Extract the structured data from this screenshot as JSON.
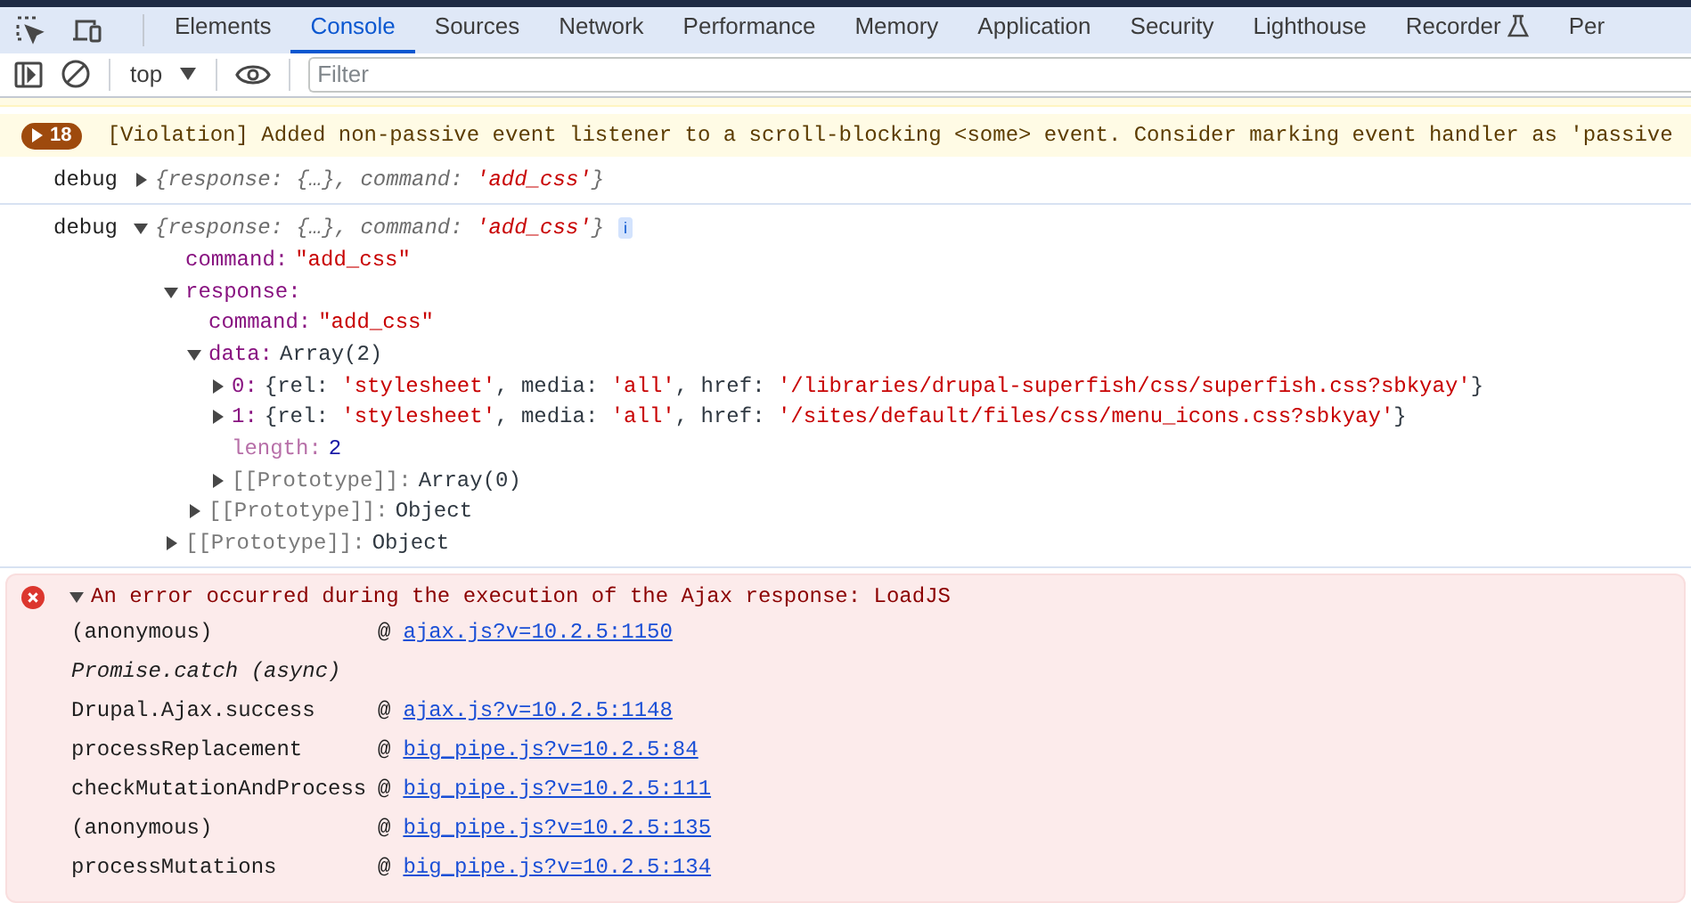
{
  "tabs": [
    {
      "label": "Elements",
      "selected": false
    },
    {
      "label": "Console",
      "selected": true
    },
    {
      "label": "Sources",
      "selected": false
    },
    {
      "label": "Network",
      "selected": false
    },
    {
      "label": "Performance",
      "selected": false
    },
    {
      "label": "Memory",
      "selected": false
    },
    {
      "label": "Application",
      "selected": false
    },
    {
      "label": "Security",
      "selected": false
    },
    {
      "label": "Lighthouse",
      "selected": false
    },
    {
      "label": "Recorder",
      "selected": false,
      "experimental": true
    },
    {
      "label": "Per",
      "selected": false
    }
  ],
  "toolbar": {
    "context": "top",
    "filter": {
      "placeholder": "Filter"
    }
  },
  "messages": [
    {
      "kind": "cut"
    },
    {
      "kind": "violation",
      "count": "18",
      "text": "[Violation] Added non-passive event listener to a scroll-blocking <some> event. Consider marking event handler as 'passive"
    },
    {
      "kind": "log",
      "label": "debug",
      "expanded": false,
      "summary": "{response: {…}, command: 'add_css'}"
    },
    {
      "kind": "log",
      "label": "debug",
      "expanded": true,
      "summary": "{response: {…}, command: 'add_css'}",
      "info": "i",
      "children": [
        {
          "key": "command:",
          "kind": "property",
          "value": "\"add_css\""
        },
        {
          "key": "response:",
          "kind": "property",
          "expanded": true,
          "children": [
            {
              "key": "command:",
              "kind": "property",
              "value": "\"add_css\""
            },
            {
              "key": "data:",
              "kind": "property",
              "value": "Array(2)",
              "expanded": true,
              "children": [
                {
                  "key": "0:",
                  "kind": "property",
                  "value": "{rel: 'stylesheet', media: 'all', href: '/libraries/drupal-superfish/css/superfish.css?sbkyay'}",
                  "expanded": false
                },
                {
                  "key": "1:",
                  "kind": "property",
                  "value": "{rel: 'stylesheet', media: 'all', href: '/sites/default/files/css/menu_icons.css?sbkyay'}",
                  "expanded": false
                },
                {
                  "key": "length:",
                  "kind": "hidden",
                  "value": "2"
                },
                {
                  "key": "[[Prototype]]:",
                  "kind": "internal",
                  "value": "Array(0)",
                  "expanded": false
                }
              ]
            },
            {
              "key": "[[Prototype]]:",
              "kind": "internal",
              "value": "Object",
              "expanded": false
            }
          ]
        },
        {
          "key": "[[Prototype]]:",
          "kind": "internal",
          "value": "Object",
          "expanded": false
        }
      ]
    },
    {
      "kind": "error",
      "expanded": true,
      "text": "An error occurred during the execution of the Ajax response: LoadJS",
      "stack": [
        {
          "fn": "(anonymous)",
          "async": false,
          "at": "@",
          "link": "ajax.js?v=10.2.5:1150"
        },
        {
          "fn": "Promise.catch (async)",
          "async": true
        },
        {
          "fn": "Drupal.Ajax.success",
          "async": false,
          "at": "@",
          "link": "ajax.js?v=10.2.5:1148"
        },
        {
          "fn": "processReplacement",
          "async": false,
          "at": "@",
          "link": "big_pipe.js?v=10.2.5:84"
        },
        {
          "fn": "checkMutationAndProcess",
          "async": false,
          "at": "@",
          "link": "big_pipe.js?v=10.2.5:111"
        },
        {
          "fn": "(anonymous)",
          "async": false,
          "at": "@",
          "link": "big_pipe.js?v=10.2.5:135"
        },
        {
          "fn": "processMutations",
          "async": false,
          "at": "@",
          "link": "big_pipe.js?v=10.2.5:134"
        }
      ]
    }
  ]
}
